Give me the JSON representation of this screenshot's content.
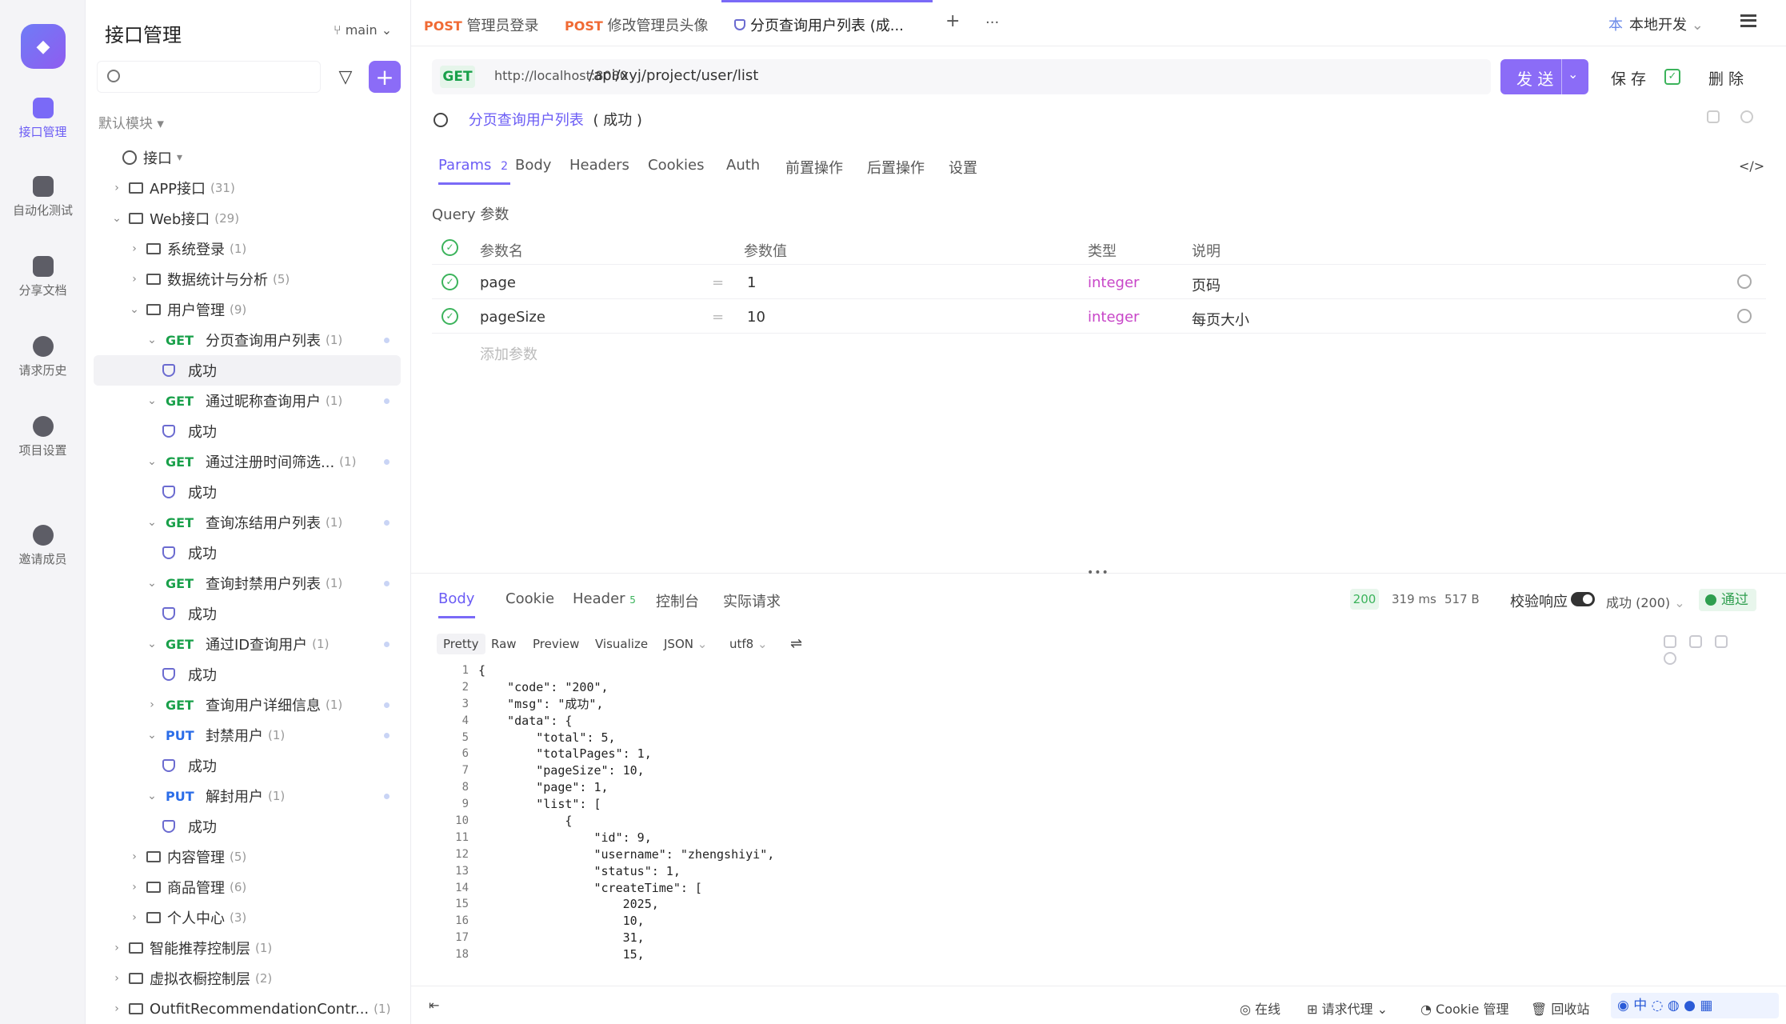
{
  "rail": {
    "items": [
      {
        "label": "接口管理",
        "icon": "api-icon",
        "active": true
      },
      {
        "label": "自动化测试",
        "icon": "automation-icon",
        "active": false
      },
      {
        "label": "分享文档",
        "icon": "book-icon",
        "active": false
      },
      {
        "label": "请求历史",
        "icon": "history-icon",
        "active": false
      },
      {
        "label": "项目设置",
        "icon": "settings-icon",
        "active": false
      },
      {
        "label": "邀请成员",
        "icon": "invite-user-icon",
        "active": false
      }
    ]
  },
  "sidebar": {
    "title": "接口管理",
    "branch": "main",
    "search_placeholder": "",
    "module": "默认模块",
    "root": "接口",
    "tree": [
      {
        "type": "folder",
        "label": "APP接口",
        "count": "(31)",
        "level": 1,
        "expanded": false
      },
      {
        "type": "folder",
        "label": "Web接口",
        "count": "(29)",
        "level": 1,
        "expanded": true
      },
      {
        "type": "folder",
        "label": "系统登录",
        "count": "(1)",
        "level": 2,
        "expanded": false
      },
      {
        "type": "folder",
        "label": "数据统计与分析",
        "count": "(5)",
        "level": 2,
        "expanded": false
      },
      {
        "type": "folder",
        "label": "用户管理",
        "count": "(9)",
        "level": 2,
        "expanded": true
      },
      {
        "type": "api",
        "method": "GET",
        "label": "分页查询用户列表",
        "count": "(1)",
        "level": 3
      },
      {
        "type": "case",
        "label": "成功",
        "level": 4,
        "selected": true
      },
      {
        "type": "api",
        "method": "GET",
        "label": "通过昵称查询用户",
        "count": "(1)",
        "level": 3
      },
      {
        "type": "case",
        "label": "成功",
        "level": 4
      },
      {
        "type": "api",
        "method": "GET",
        "label": "通过注册时间筛选...",
        "count": "(1)",
        "level": 3
      },
      {
        "type": "case",
        "label": "成功",
        "level": 4
      },
      {
        "type": "api",
        "method": "GET",
        "label": "查询冻结用户列表",
        "count": "(1)",
        "level": 3
      },
      {
        "type": "case",
        "label": "成功",
        "level": 4
      },
      {
        "type": "api",
        "method": "GET",
        "label": "查询封禁用户列表",
        "count": "(1)",
        "level": 3
      },
      {
        "type": "case",
        "label": "成功",
        "level": 4
      },
      {
        "type": "api",
        "method": "GET",
        "label": "通过ID查询用户",
        "count": "(1)",
        "level": 3
      },
      {
        "type": "case",
        "label": "成功",
        "level": 4
      },
      {
        "type": "api",
        "method": "GET",
        "label": "查询用户详细信息",
        "count": "(1)",
        "level": 3,
        "collapsed": true
      },
      {
        "type": "api",
        "method": "PUT",
        "label": "封禁用户",
        "count": "(1)",
        "level": 3
      },
      {
        "type": "case",
        "label": "成功",
        "level": 4
      },
      {
        "type": "api",
        "method": "PUT",
        "label": "解封用户",
        "count": "(1)",
        "level": 3
      },
      {
        "type": "case",
        "label": "成功",
        "level": 4
      },
      {
        "type": "folder",
        "label": "内容管理",
        "count": "(5)",
        "level": 2,
        "expanded": false
      },
      {
        "type": "folder",
        "label": "商品管理",
        "count": "(6)",
        "level": 2,
        "expanded": false
      },
      {
        "type": "folder",
        "label": "个人中心",
        "count": "(3)",
        "level": 2,
        "expanded": false
      },
      {
        "type": "folder",
        "label": "智能推荐控制层",
        "count": "(1)",
        "level": 1,
        "expanded": false
      },
      {
        "type": "folder",
        "label": "虚拟衣橱控制层",
        "count": "(2)",
        "level": 1,
        "expanded": false
      },
      {
        "type": "folder",
        "label": "OutfitRecommendationContr...",
        "count": "(1)",
        "level": 1,
        "expanded": false
      }
    ]
  },
  "tabs": [
    {
      "method": "POST",
      "label": "管理员登录"
    },
    {
      "method": "POST",
      "label": "修改管理员头像"
    },
    {
      "method": "",
      "label": "分页查询用户列表 (成..."
    }
  ],
  "tab_add": "+",
  "tab_more": "···",
  "env": "本地开发",
  "request": {
    "method": "GET",
    "host": "http://localhost:8080",
    "path": "/api/xyj/project/user/list",
    "send": "发 送",
    "save": "保 存",
    "delete": "删 除",
    "name": "分页查询用户列表",
    "case": "( 成功 )"
  },
  "param_tabs": [
    "Params",
    "Body",
    "Headers",
    "Cookies",
    "Auth",
    "前置操作",
    "后置操作",
    "设置"
  ],
  "params_count": "2",
  "query_label": "Query 参数",
  "param_headers": {
    "name": "参数名",
    "value": "参数值",
    "type": "类型",
    "desc": "说明"
  },
  "params": [
    {
      "name": "page",
      "value": "1",
      "type": "integer",
      "desc": "页码"
    },
    {
      "name": "pageSize",
      "value": "10",
      "type": "integer",
      "desc": "每页大小"
    }
  ],
  "add_param": "添加参数",
  "response": {
    "tabs": [
      "Body",
      "Cookie",
      "Header",
      "控制台",
      "实际请求"
    ],
    "header_count": "5",
    "status": "200",
    "time": "319 ms",
    "size": "517 B",
    "validate_label": "校验响应",
    "validate_select": "成功 (200)",
    "pass": "通过",
    "formats": [
      "Pretty",
      "Raw",
      "Preview",
      "Visualize"
    ],
    "lang": "JSON",
    "encoding": "utf8",
    "lines": [
      "{",
      "    \"code\": \"200\",",
      "    \"msg\": \"成功\",",
      "    \"data\": {",
      "        \"total\": 5,",
      "        \"totalPages\": 1,",
      "        \"pageSize\": 10,",
      "        \"page\": 1,",
      "        \"list\": [",
      "            {",
      "                \"id\": 9,",
      "                \"username\": \"zhengshiyi\",",
      "                \"status\": 1,",
      "                \"createTime\": [",
      "                    2025,",
      "                    10,",
      "                    31,",
      "                    15,"
    ]
  },
  "statusbar": {
    "online": "在线",
    "proxy": "请求代理",
    "cookie": "Cookie 管理",
    "recycle": "回收站",
    "ime": "中"
  },
  "colors": {
    "accent": "#7a6af7",
    "get": "#19a04a",
    "put": "#2b6de8",
    "post": "#f06a34",
    "integer": "#c846c8"
  }
}
